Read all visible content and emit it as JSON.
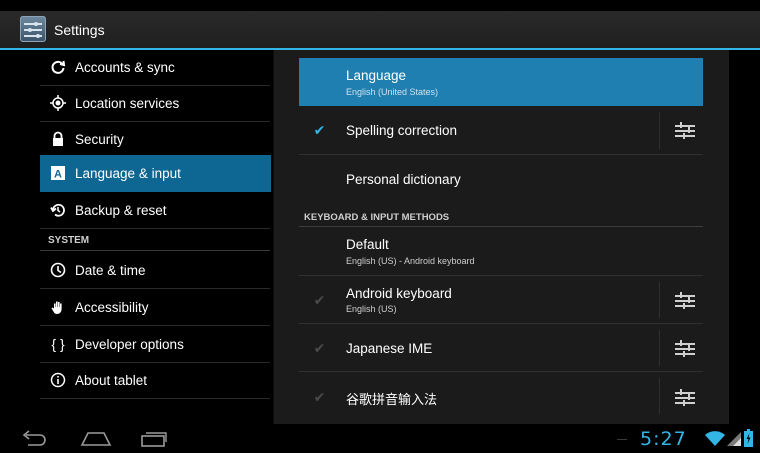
{
  "action_bar": {
    "title": "Settings",
    "icon": "settings-icon"
  },
  "left_pane": {
    "items": [
      {
        "label": "Accounts & sync",
        "icon": "sync-icon"
      },
      {
        "label": "Location services",
        "icon": "location-icon"
      },
      {
        "label": "Security",
        "icon": "lock-icon"
      },
      {
        "label": "Language & input",
        "icon": "language-icon",
        "selected": true
      },
      {
        "label": "Backup & reset",
        "icon": "backup-icon"
      }
    ],
    "system_header": "SYSTEM",
    "system_items": [
      {
        "label": "Date & time",
        "icon": "clock-icon"
      },
      {
        "label": "Accessibility",
        "icon": "hand-icon"
      },
      {
        "label": "Developer options",
        "icon": "braces-icon"
      },
      {
        "label": "About tablet",
        "icon": "info-icon"
      }
    ]
  },
  "right_pane": {
    "language": {
      "title": "Language",
      "subtitle": "English (United States)"
    },
    "spelling": {
      "title": "Spelling correction",
      "checked": true
    },
    "dictionary": {
      "title": "Personal dictionary"
    },
    "methods_header": "KEYBOARD & INPUT METHODS",
    "default": {
      "title": "Default",
      "subtitle": "English (US) - Android keyboard"
    },
    "methods": [
      {
        "title": "Android keyboard",
        "subtitle": "English (US)",
        "checked": true
      },
      {
        "title": "Japanese IME",
        "subtitle": "",
        "checked": true
      },
      {
        "title": "谷歌拼音输入法",
        "subtitle": "",
        "checked": true
      }
    ]
  },
  "status_bar": {
    "time": "5:27"
  },
  "colors": {
    "accent": "#33b5e5",
    "selected_left": "#0e6793",
    "selected_right": "#1f7fb0"
  }
}
